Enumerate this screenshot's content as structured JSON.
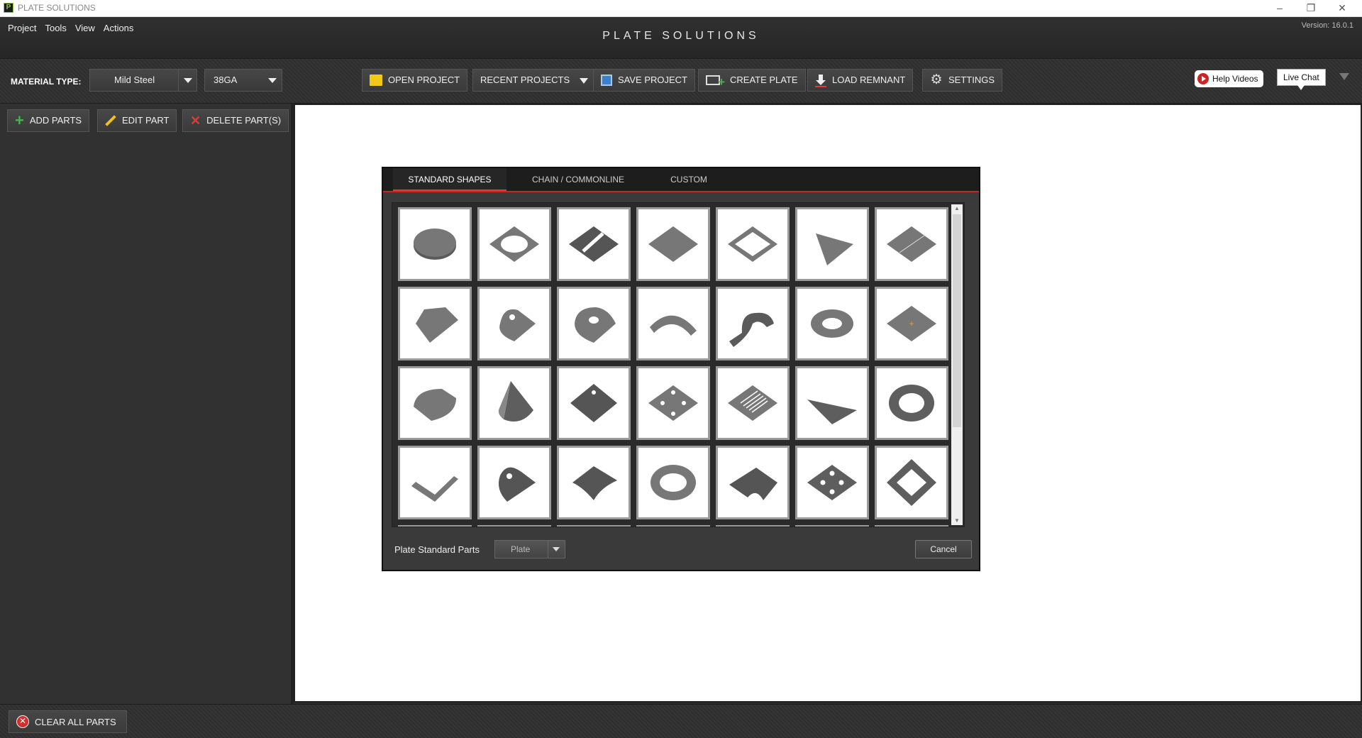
{
  "window": {
    "title": "PLATE SOLUTIONS",
    "controls": {
      "minimize": "–",
      "restore": "❐",
      "close": "✕"
    }
  },
  "menu": [
    "Project",
    "Tools",
    "View",
    "Actions"
  ],
  "app_title": "PLATE SOLUTIONS",
  "version": "Version: 16.0.1",
  "toolbar": {
    "material_label": "MATERIAL TYPE:",
    "material_value": "Mild Steel",
    "gauge_value": "38GA",
    "open_project": "OPEN PROJECT",
    "recent_projects": "RECENT PROJECTS",
    "save_project": "SAVE PROJECT",
    "create_plate": "CREATE PLATE",
    "load_remnant": "LOAD REMNANT",
    "settings": "SETTINGS",
    "help_videos": "Help Videos",
    "live_chat": "Live Chat"
  },
  "left": {
    "add_parts": "ADD PARTS",
    "edit_part": "EDIT PART",
    "delete_parts": "DELETE PART(S)"
  },
  "bottom": {
    "clear_all": "CLEAR ALL PARTS"
  },
  "dialog": {
    "tabs": [
      "STANDARD SHAPES",
      "CHAIN / COMMONLINE",
      "CUSTOM"
    ],
    "active_tab": "STANDARD SHAPES",
    "shapes": [
      "round-disc",
      "square-ring",
      "striped-plate",
      "square-plate",
      "square-frame",
      "triangle",
      "split-plate",
      "chamfered-plate",
      "lug-plate",
      "eye-plate",
      "arc-strip",
      "bent-bracket",
      "round-ring",
      "marked-plate",
      "half-round-plate",
      "cone",
      "hole-diamond-plate",
      "four-hole-plate",
      "grating",
      "flat-triangle",
      "bolt-flange",
      "angle-strip",
      "pad-eye",
      "curved-plate",
      "hole-ring-flange",
      "notched-plate",
      "four-hole-square",
      "perforated-frame"
    ],
    "footer_label": "Plate Standard Parts",
    "select_value": "Plate",
    "cancel": "Cancel"
  }
}
